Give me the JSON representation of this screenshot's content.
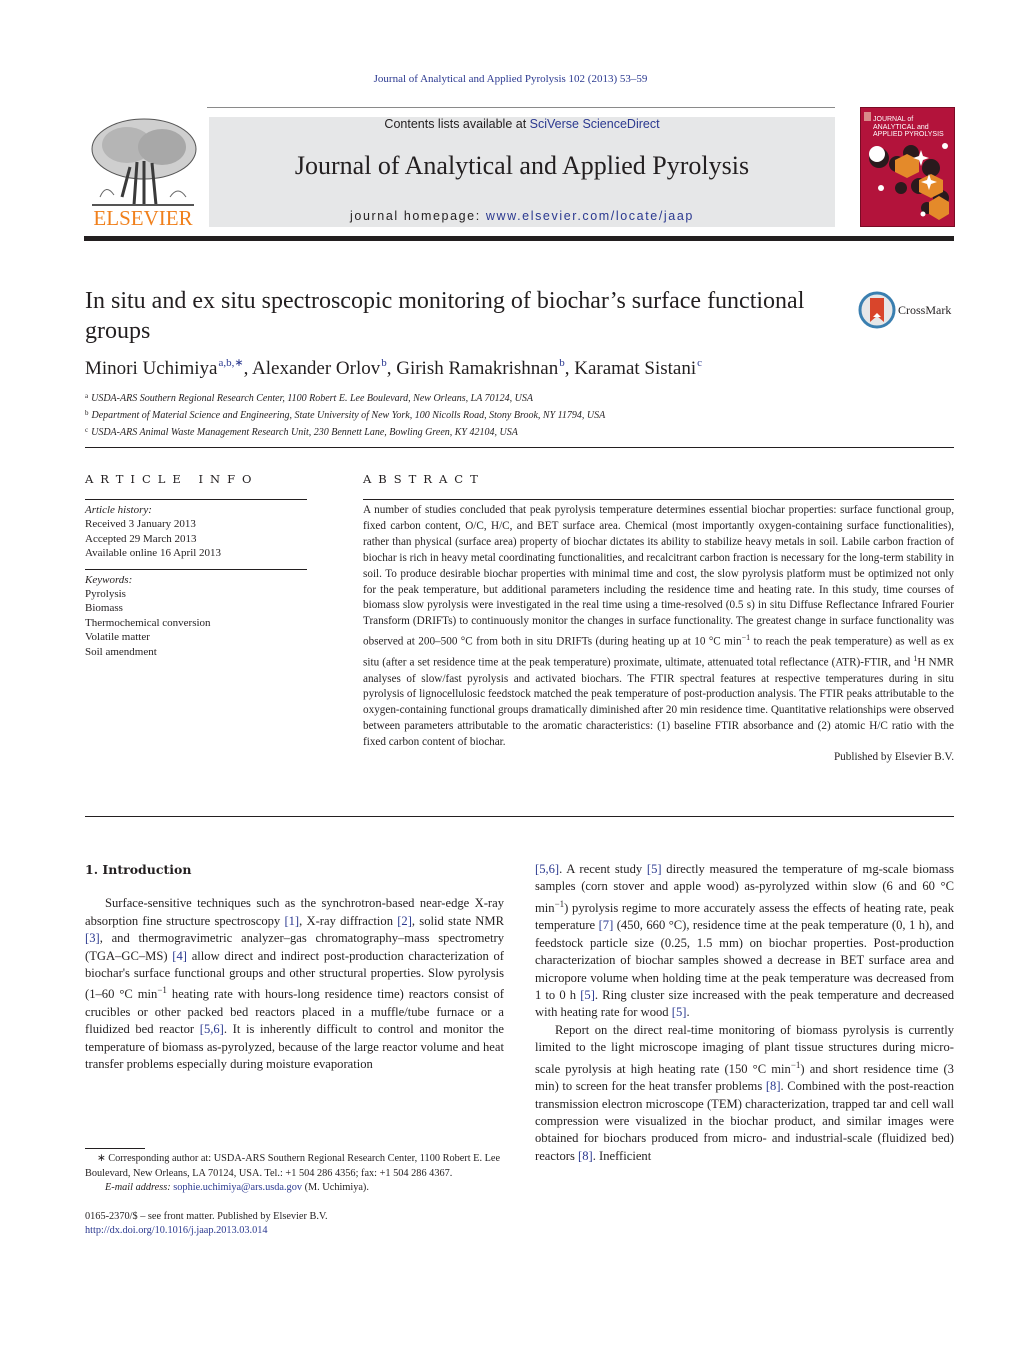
{
  "running_head": "Journal of Analytical and Applied Pyrolysis 102 (2013) 53–59",
  "masthead": {
    "publisher": "ELSEVIER",
    "contents_prefix": "Contents lists available at ",
    "contents_link": "SciVerse ScienceDirect",
    "journal_title": "Journal of Analytical and Applied Pyrolysis",
    "homepage_prefix": "journal homepage: ",
    "homepage_link": "www.elsevier.com/locate/jaap",
    "cover_title_lines": [
      "JOURNAL of",
      "ANALYTICAL and",
      "APPLIED PYROLYSIS"
    ]
  },
  "colors": {
    "link": "#2b3990",
    "elsevier_orange": "#f0801c",
    "cover_red": "#b3133b",
    "masthead_gray": "#e6e7e8"
  },
  "article": {
    "title": "In situ and ex situ spectroscopic monitoring of biochar’s surface functional groups",
    "crossmark_label": "CrossMark",
    "authors": [
      {
        "name": "Minori Uchimiya",
        "sup": "a,b,∗",
        "sep": ", "
      },
      {
        "name": "Alexander Orlov",
        "sup": "b",
        "sep": ", "
      },
      {
        "name": "Girish Ramakrishnan",
        "sup": "b",
        "sep": ", "
      },
      {
        "name": "Karamat Sistani",
        "sup": "c",
        "sep": ""
      }
    ],
    "affiliations": [
      {
        "mark": "a",
        "text": "USDA-ARS Southern Regional Research Center, 1100 Robert E. Lee Boulevard, New Orleans, LA 70124, USA"
      },
      {
        "mark": "b",
        "text": "Department of Material Science and Engineering, State University of New York, 100 Nicolls Road, Stony Brook, NY 11794, USA"
      },
      {
        "mark": "c",
        "text": "USDA-ARS Animal Waste Management Research Unit, 230 Bennett Lane, Bowling Green, KY 42104, USA"
      }
    ]
  },
  "article_info": {
    "heading": "ARTICLE INFO",
    "history_label": "Article history:",
    "history": [
      "Received 3 January 2013",
      "Accepted 29 March 2013",
      "Available online 16 April 2013"
    ],
    "keywords_label": "Keywords:",
    "keywords": [
      "Pyrolysis",
      "Biomass",
      "Thermochemical conversion",
      "Volatile matter",
      "Soil amendment"
    ]
  },
  "abstract": {
    "heading": "ABSTRACT",
    "text_part1": "A number of studies concluded that peak pyrolysis temperature determines essential biochar properties: surface functional group, fixed carbon content, O/C, H/C, and BET surface area. Chemical (most importantly oxygen-containing surface functionalities), rather than physical (surface area) property of biochar dictates its ability to stabilize heavy metals in soil. Labile carbon fraction of biochar is rich in heavy metal coordinating functionalities, and recalcitrant carbon fraction is necessary for the long-term stability in soil. To produce desirable biochar properties with minimal time and cost, the slow pyrolysis platform must be optimized not only for the peak temperature, but additional parameters including the residence time and heating rate. In this study, time courses of biomass slow pyrolysis were investigated in the real time using a time-resolved (0.5 s) in situ Diffuse Reflectance Infrared Fourier Transform (DRIFTs) to continuously monitor the changes in surface functionality. The greatest change in surface functionality was observed at 200–500 °C from both in situ DRIFTs (during heating up at 10 °C min",
    "sup1": "−1",
    "text_part2": " to reach the peak temperature) as well as ex situ (after a set residence time at the peak temperature) proximate, ultimate, attenuated total reflectance (ATR)-FTIR, and ",
    "sup2": "1",
    "text_part3": "H NMR analyses of slow/fast pyrolysis and activated biochars. The FTIR spectral features at respective temperatures during in situ pyrolysis of lignocellulosic feedstock matched the peak temperature of post-production analysis. The FTIR peaks attributable to the oxygen-containing functional groups dramatically diminished after 20 min residence time. Quantitative relationships were observed between parameters attributable to the aromatic characteristics: (1) baseline FTIR absorbance and (2) atomic H/C ratio with the fixed carbon content of biochar.",
    "published_by": "Published by Elsevier B.V."
  },
  "introduction": {
    "heading": "1.  Introduction",
    "left_col": [
      {
        "t": "Surface-sensitive techniques such as the synchrotron-based near-edge X-ray absorption fine structure spectroscopy "
      },
      {
        "ref": "[1]"
      },
      {
        "t": ", X-ray diffraction "
      },
      {
        "ref": "[2]"
      },
      {
        "t": ", solid state NMR "
      },
      {
        "ref": "[3]"
      },
      {
        "t": ", and thermogravimetric analyzer–gas chromatography–mass spectrometry (TGA–GC–MS) "
      },
      {
        "ref": "[4]"
      },
      {
        "t": " allow direct and indirect post-production characterization of biochar's surface functional groups and other structural properties. Slow pyrolysis (1–60 °C min"
      },
      {
        "sup": "−1"
      },
      {
        "t": " heating rate with hours-long residence time) reactors consist of crucibles or other packed bed reactors placed in a muffle/tube furnace or a fluidized bed reactor "
      },
      {
        "ref": "[5,6]"
      },
      {
        "t": ". It is inherently difficult to control and monitor the temperature of biomass as-pyrolyzed, because of the large reactor volume and heat transfer problems especially during moisture evaporation"
      }
    ],
    "right_col_p1": [
      {
        "ref": "[5,6]"
      },
      {
        "t": ". A recent study "
      },
      {
        "ref": "[5]"
      },
      {
        "t": " directly measured the temperature of mg-scale biomass samples (corn stover and apple wood) as-pyrolyzed within slow (6 and 60 °C min"
      },
      {
        "sup": "−1"
      },
      {
        "t": ") pyrolysis regime to more accurately assess the effects of heating rate, peak temperature "
      },
      {
        "ref": "[7]"
      },
      {
        "t": " (450, 660 °C), residence time at the peak temperature (0, 1 h), and feedstock particle size (0.25, 1.5 mm) on biochar properties. Post-production characterization of biochar samples showed a decrease in BET surface area and micropore volume when holding time at the peak temperature was decreased from 1 to 0 h "
      },
      {
        "ref": "[5]"
      },
      {
        "t": ". Ring cluster size increased with the peak temperature and decreased with heating rate for wood "
      },
      {
        "ref": "[5]"
      },
      {
        "t": "."
      }
    ],
    "right_col_p2": [
      {
        "t": "Report on the direct real-time monitoring of biomass pyrolysis is currently limited to the light microscope imaging of plant tissue structures during micro-scale pyrolysis at high heating rate (150 °C min"
      },
      {
        "sup": "−1"
      },
      {
        "t": ") and short residence time (3 min) to screen for the heat transfer problems "
      },
      {
        "ref": "[8]"
      },
      {
        "t": ". Combined with the post-reaction transmission electron microscope (TEM) characterization, trapped tar and cell wall compression were visualized in the biochar product, and similar images were obtained for biochars produced from micro- and industrial-scale (fluidized bed) reactors "
      },
      {
        "ref": "[8]"
      },
      {
        "t": ". Inefficient"
      }
    ]
  },
  "footnotes": {
    "corresponding": "∗  Corresponding author at: USDA-ARS Southern Regional Research Center, 1100 Robert E. Lee Boulevard, New Orleans, LA 70124, USA. Tel.: +1 504 286 4356; fax: +1 504 286 4367.",
    "email_label": "E-mail address: ",
    "email": "sophie.uchimiya@ars.usda.gov",
    "email_suffix": " (M. Uchimiya).",
    "issn_line": "0165-2370/$ – see front matter. Published by Elsevier B.V.",
    "doi": "http://dx.doi.org/10.1016/j.jaap.2013.03.014"
  }
}
